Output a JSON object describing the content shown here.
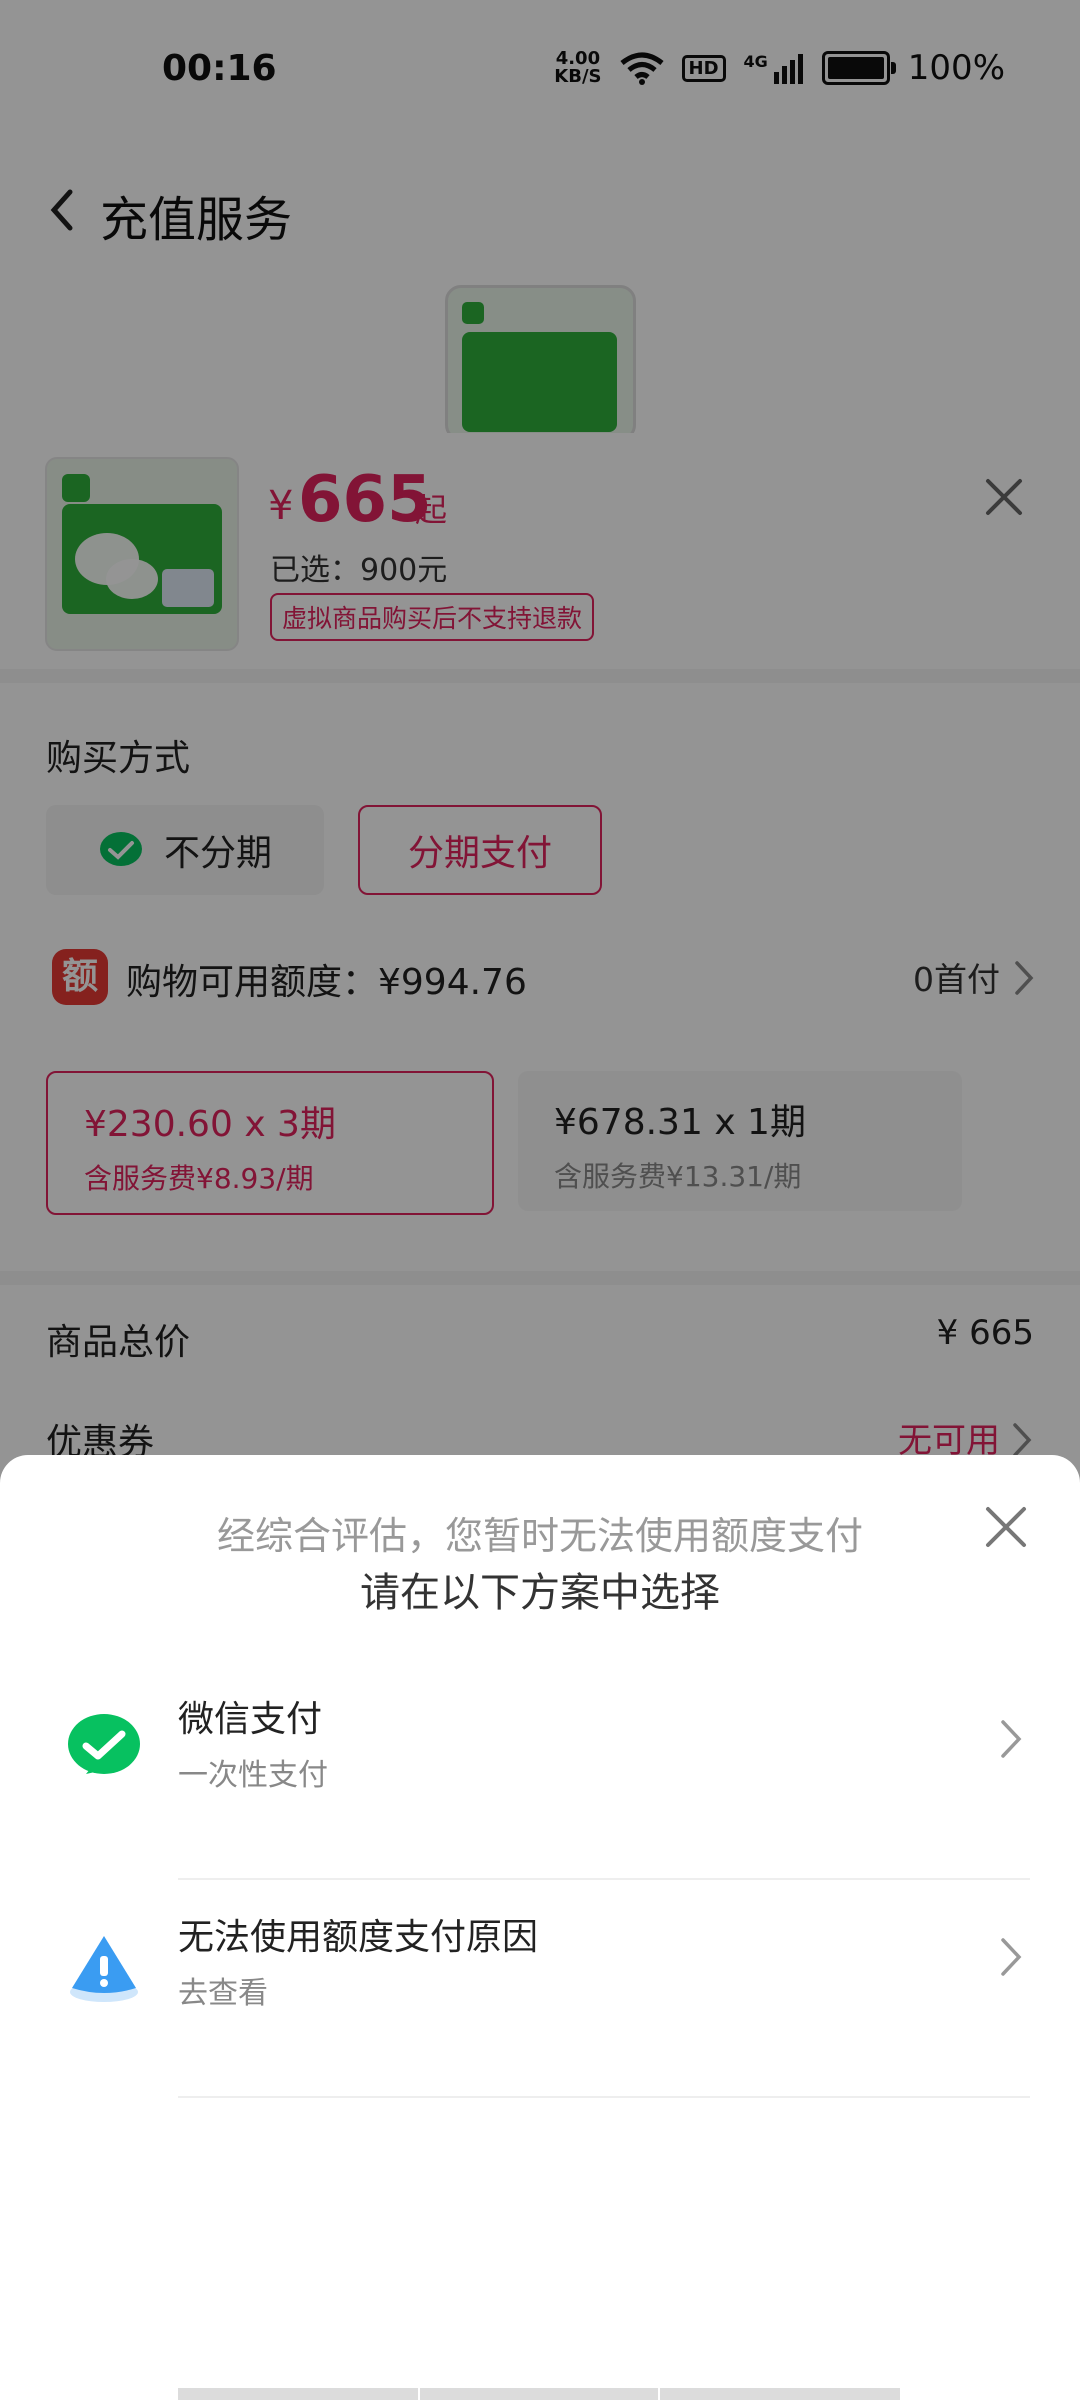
{
  "status_bar": {
    "time": "00:16",
    "speed_value": "4.00",
    "speed_unit": "KB/S",
    "hd": "HD",
    "network": "4G",
    "battery_percent": "100%",
    "battery_level": 1.0
  },
  "header": {
    "title": "充值服务"
  },
  "product": {
    "currency": "¥",
    "price": "665",
    "price_suffix": "起",
    "selected": "已选：900元",
    "no_refund": "虚拟商品购买后不支持退款"
  },
  "purchase": {
    "label": "购买方式",
    "option_no_installment": "不分期",
    "option_installment": "分期支付"
  },
  "quota": {
    "icon_text": "额",
    "label": "购物可用额度：¥994.76",
    "right_text": "0首付"
  },
  "plans": [
    {
      "main": "¥230.60 x 3期",
      "sub": "含服务费¥8.93/期"
    },
    {
      "main": "¥678.31 x 1期",
      "sub": "含服务费¥13.31/期"
    }
  ],
  "summary": {
    "total_label": "商品总价",
    "total_value": "¥ 665",
    "coupon_label": "优惠券",
    "coupon_value": "无可用"
  },
  "dialog": {
    "line1": "经综合评估，您暂时无法使用额度支付",
    "line2": "请在以下方案中选择",
    "options": [
      {
        "title": "微信支付",
        "subtitle": "一次性支付"
      },
      {
        "title": "无法使用额度支付原因",
        "subtitle": "去查看"
      }
    ]
  },
  "colors": {
    "accent": "#e0245e",
    "wechat_green": "#07c160",
    "overlay": "rgba(0,0,0,0.42)"
  }
}
